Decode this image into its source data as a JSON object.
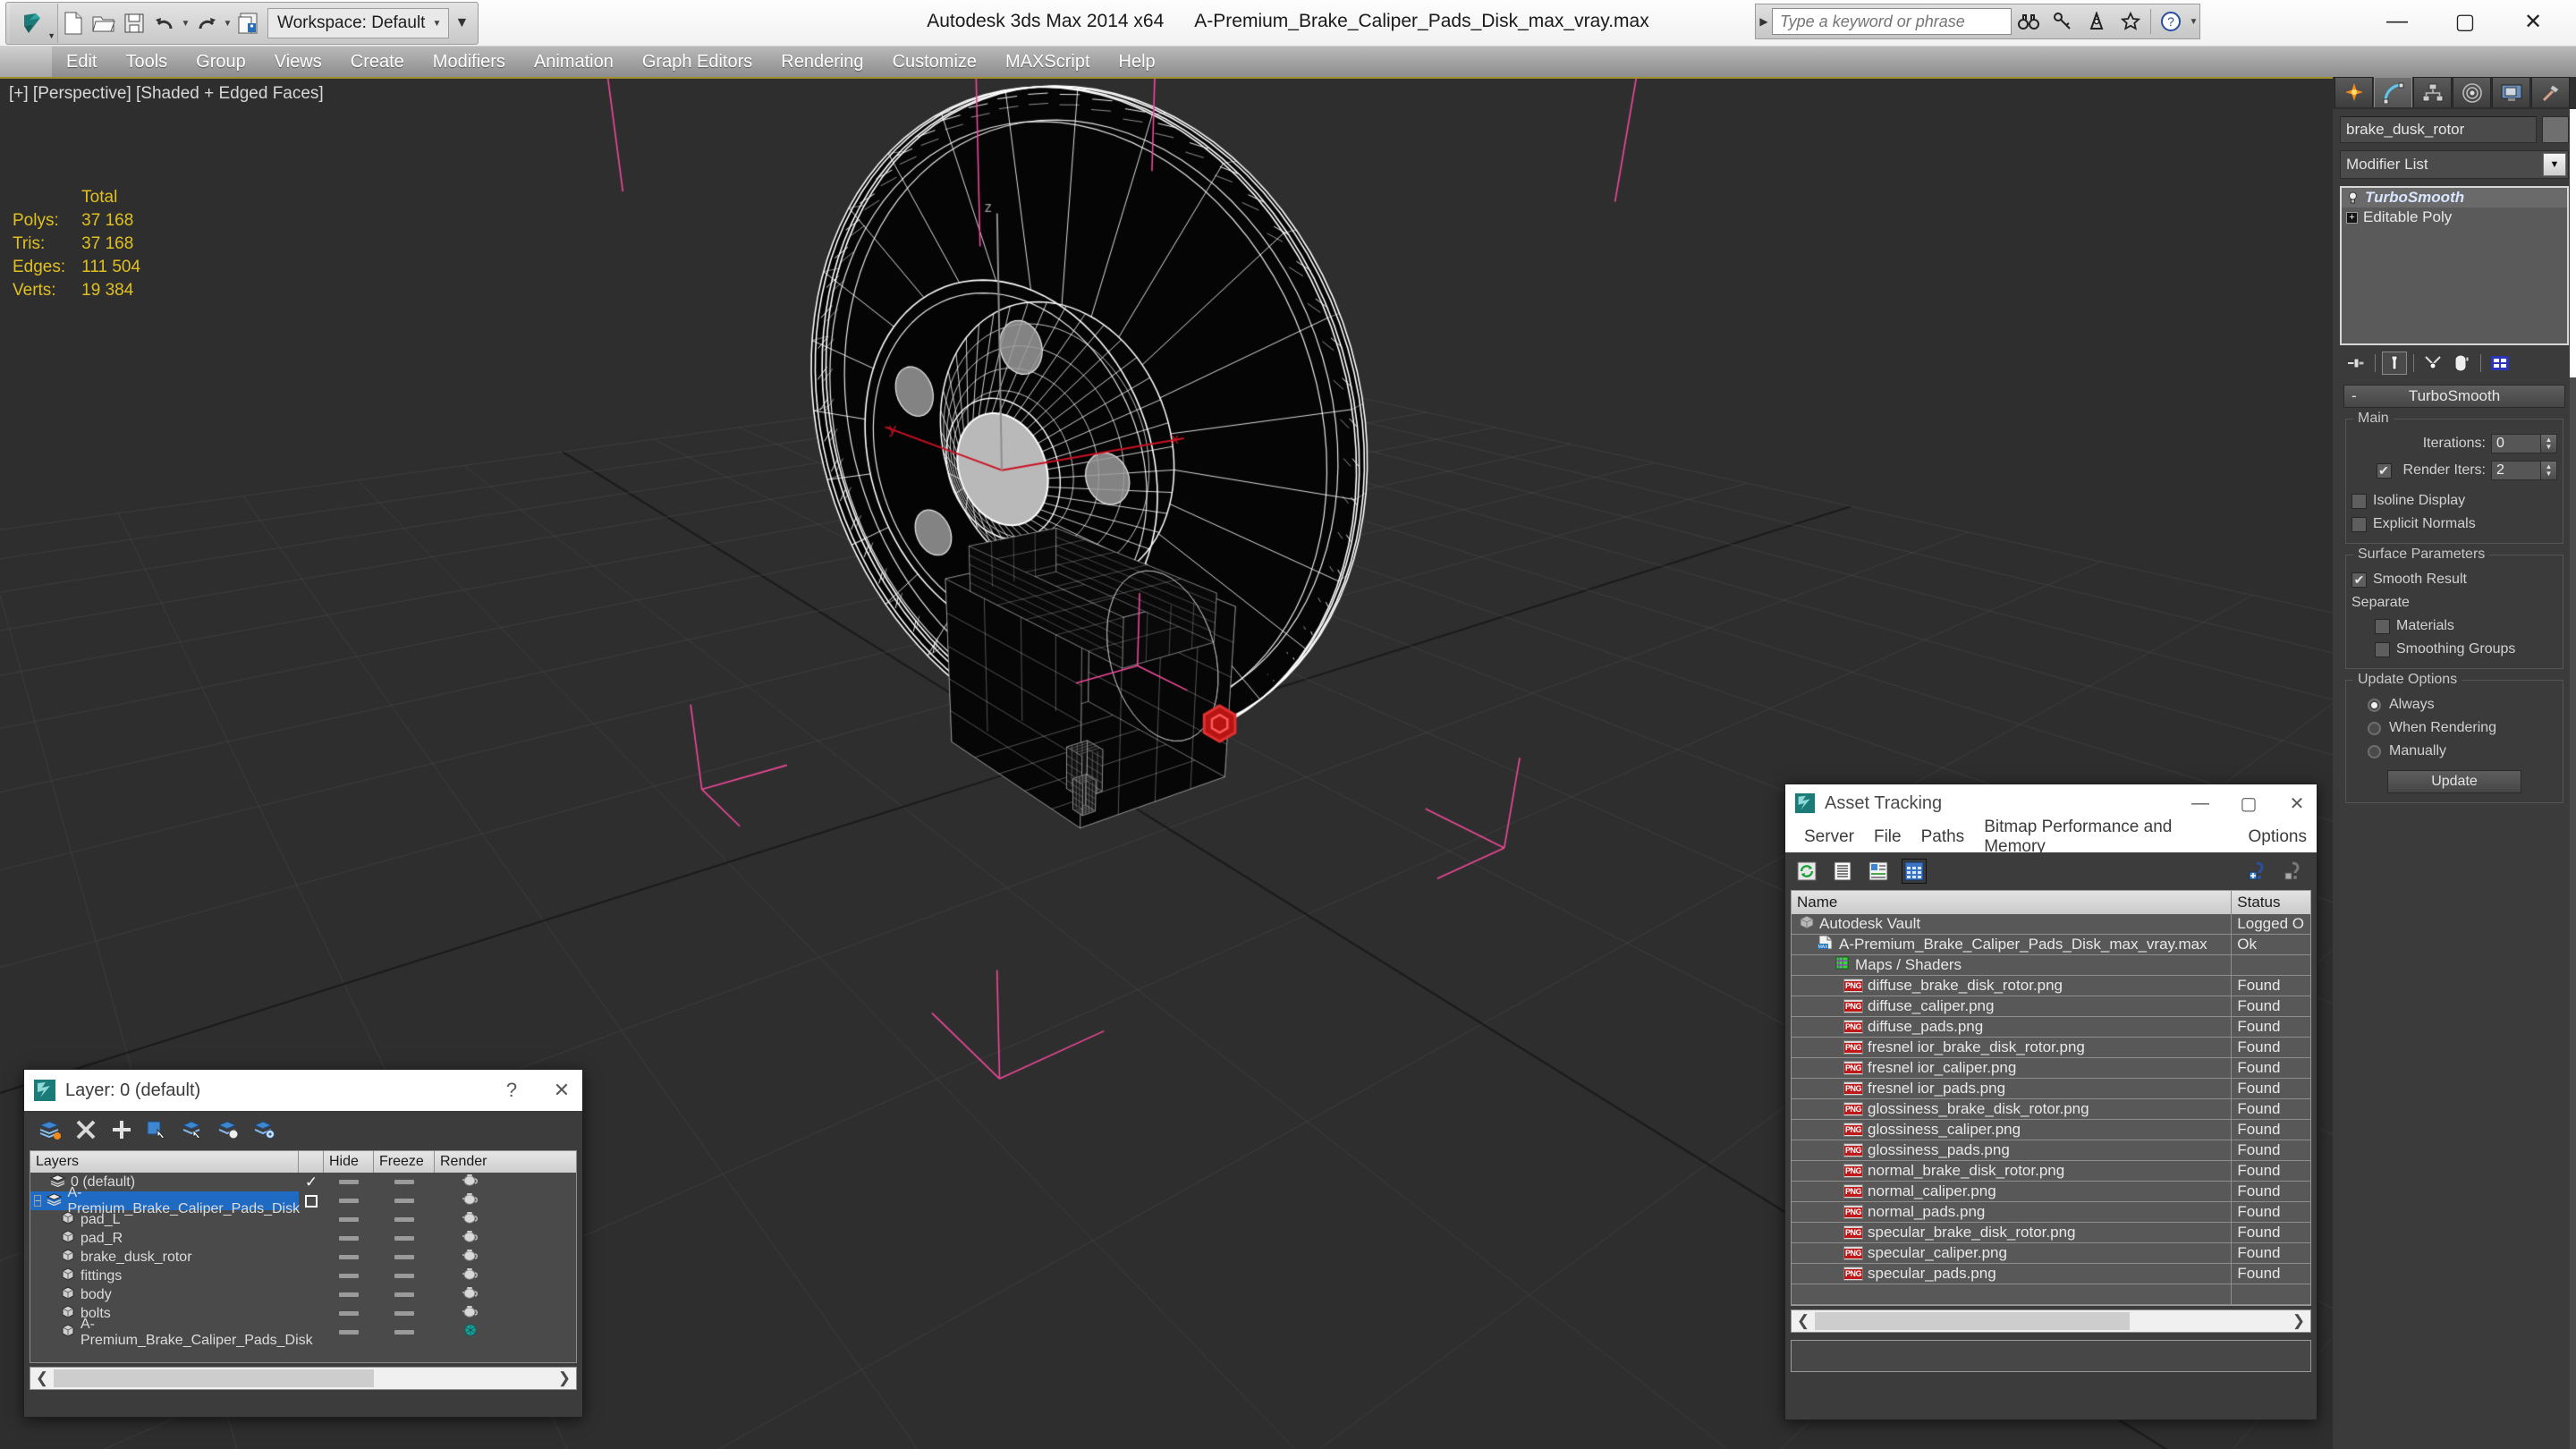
{
  "titlebar": {
    "app_title": "Autodesk 3ds Max  2014 x64",
    "file_title": "A-Premium_Brake_Caliper_Pads_Disk_max_vray.max",
    "workspace_label": "Workspace: Default",
    "search_placeholder": "Type a keyword or phrase",
    "quick_access": [
      "new-file-icon",
      "open-file-icon",
      "save-file-icon",
      "undo-icon",
      "redo-icon",
      "set-project-folder-icon"
    ],
    "help_icons": [
      "binoculars-icon",
      "key-icon",
      "compass-icon",
      "star-icon",
      "question-icon"
    ],
    "window_buttons": {
      "minimize": "—",
      "maximize": "▢",
      "close": "✕"
    }
  },
  "menu": {
    "items": [
      "Edit",
      "Tools",
      "Group",
      "Views",
      "Create",
      "Modifiers",
      "Animation",
      "Graph Editors",
      "Rendering",
      "Customize",
      "MAXScript",
      "Help"
    ]
  },
  "viewport": {
    "label": "[+] [Perspective] [Shaded + Edged Faces]",
    "stats_header": "Total",
    "stats": [
      {
        "label": "Polys:",
        "value": "37 168"
      },
      {
        "label": "Tris:",
        "value": "37 168"
      },
      {
        "label": "Edges:",
        "value": "111 504"
      },
      {
        "label": "Verts:",
        "value": "19 384"
      }
    ],
    "axis_labels": {
      "x": "x",
      "y": "y",
      "z": "z"
    },
    "colors": {
      "background": "#2e2e2e",
      "wireframe": "#ffffff",
      "selection_bracket": "#f0489a",
      "x_axis": "#cc1122",
      "stats_text": "#e0c020"
    }
  },
  "command_panel": {
    "tabs": [
      "create-tab",
      "modify-tab",
      "hierarchy-tab",
      "motion-tab",
      "display-tab",
      "utilities-tab"
    ],
    "active_tab": "modify-tab",
    "object_name": "brake_dusk_rotor",
    "modifier_list_label": "Modifier List",
    "stack": [
      {
        "label": "TurboSmooth",
        "italic": true,
        "selected": true
      },
      {
        "label": "Editable Poly",
        "italic": false,
        "selected": false
      }
    ],
    "stack_tools": [
      "pin-stack-icon",
      "show-end-result-icon",
      "make-unique-icon",
      "remove-modifier-icon",
      "configure-modifier-sets-icon"
    ],
    "rollout": {
      "title": "TurboSmooth",
      "minus": "-",
      "groups": [
        {
          "title": "Main",
          "iterations_label": "Iterations:",
          "iterations_value": "0",
          "render_iters_label": "Render Iters:",
          "render_iters_value": "2",
          "render_iters_checked": true,
          "isoline_label": "Isoline Display",
          "isoline_checked": false,
          "explicit_label": "Explicit Normals",
          "explicit_checked": false
        },
        {
          "title": "Surface Parameters",
          "smooth_result_label": "Smooth Result",
          "smooth_result_checked": true,
          "separate_label": "Separate",
          "materials_label": "Materials",
          "materials_checked": false,
          "smoothing_groups_label": "Smoothing Groups",
          "smoothing_groups_checked": false
        },
        {
          "title": "Update Options",
          "options": [
            {
              "label": "Always",
              "selected": true
            },
            {
              "label": "When Rendering",
              "selected": false
            },
            {
              "label": "Manually",
              "selected": false
            }
          ],
          "update_button": "Update"
        }
      ]
    }
  },
  "layer_dialog": {
    "title": "Layer: 0 (default)",
    "help_button": "?",
    "close_button": "✕",
    "toolbar": [
      "new-layer-icon",
      "delete-layer-icon",
      "add-selection-icon",
      "select-objects-icon",
      "select-highlighted-icon",
      "highlight-selected-icon",
      "layer-properties-icon"
    ],
    "columns": [
      "Layers",
      "",
      "Hide",
      "Freeze",
      "Render"
    ],
    "rows": [
      {
        "name": "0 (default)",
        "type": "layer",
        "indent": 1,
        "selected": false,
        "checkmark": true,
        "box": false,
        "render": "teapot"
      },
      {
        "name": "A-Premium_Brake_Caliper_Pads_Disk",
        "type": "layer",
        "indent": 0,
        "selected": true,
        "checkmark": false,
        "box": true,
        "render": "teapot",
        "expander": "−"
      },
      {
        "name": "pad_L",
        "type": "object",
        "indent": 2,
        "selected": false,
        "render": "teapot"
      },
      {
        "name": "pad_R",
        "type": "object",
        "indent": 2,
        "selected": false,
        "render": "teapot"
      },
      {
        "name": "brake_dusk_rotor",
        "type": "object",
        "indent": 2,
        "selected": false,
        "render": "teapot"
      },
      {
        "name": "fittings",
        "type": "object",
        "indent": 2,
        "selected": false,
        "render": "teapot"
      },
      {
        "name": "body",
        "type": "object",
        "indent": 2,
        "selected": false,
        "render": "teapot"
      },
      {
        "name": "bolts",
        "type": "object",
        "indent": 2,
        "selected": false,
        "render": "teapot"
      },
      {
        "name": "A-Premium_Brake_Caliper_Pads_Disk",
        "type": "object",
        "indent": 2,
        "selected": false,
        "render": "group"
      }
    ]
  },
  "asset_tracking": {
    "title": "Asset Tracking",
    "window_buttons": {
      "minimize": "—",
      "maximize": "▢",
      "close": "✕"
    },
    "menu": [
      "Server",
      "File",
      "Paths",
      "Bitmap Performance and Memory",
      "Options"
    ],
    "toolbar": [
      "refresh-icon",
      "list-view-icon",
      "details-view-icon",
      "grid-view-icon"
    ],
    "help_icons": [
      "new-help-icon",
      "help-icon"
    ],
    "columns": [
      "Name",
      "Status"
    ],
    "rows": [
      {
        "name": "Autodesk Vault",
        "status": "Logged O",
        "icon": "vault-icon",
        "indent": 0
      },
      {
        "name": "A-Premium_Brake_Caliper_Pads_Disk_max_vray.max",
        "status": "Ok",
        "icon": "max-file-icon",
        "indent": 1
      },
      {
        "name": "Maps / Shaders",
        "status": "",
        "icon": "maps-shaders-icon",
        "indent": 2
      },
      {
        "name": "diffuse_brake_disk_rotor.png",
        "status": "Found",
        "icon": "png-icon",
        "indent": 3
      },
      {
        "name": "diffuse_caliper.png",
        "status": "Found",
        "icon": "png-icon",
        "indent": 3
      },
      {
        "name": "diffuse_pads.png",
        "status": "Found",
        "icon": "png-icon",
        "indent": 3
      },
      {
        "name": "fresnel ior_brake_disk_rotor.png",
        "status": "Found",
        "icon": "png-icon",
        "indent": 3
      },
      {
        "name": "fresnel ior_caliper.png",
        "status": "Found",
        "icon": "png-icon",
        "indent": 3
      },
      {
        "name": "fresnel ior_pads.png",
        "status": "Found",
        "icon": "png-icon",
        "indent": 3
      },
      {
        "name": "glossiness_brake_disk_rotor.png",
        "status": "Found",
        "icon": "png-icon",
        "indent": 3
      },
      {
        "name": "glossiness_caliper.png",
        "status": "Found",
        "icon": "png-icon",
        "indent": 3
      },
      {
        "name": "glossiness_pads.png",
        "status": "Found",
        "icon": "png-icon",
        "indent": 3
      },
      {
        "name": "normal_brake_disk_rotor.png",
        "status": "Found",
        "icon": "png-icon",
        "indent": 3
      },
      {
        "name": "normal_caliper.png",
        "status": "Found",
        "icon": "png-icon",
        "indent": 3
      },
      {
        "name": "normal_pads.png",
        "status": "Found",
        "icon": "png-icon",
        "indent": 3
      },
      {
        "name": "specular_brake_disk_rotor.png",
        "status": "Found",
        "icon": "png-icon",
        "indent": 3
      },
      {
        "name": "specular_caliper.png",
        "status": "Found",
        "icon": "png-icon",
        "indent": 3
      },
      {
        "name": "specular_pads.png",
        "status": "Found",
        "icon": "png-icon",
        "indent": 3
      }
    ]
  }
}
